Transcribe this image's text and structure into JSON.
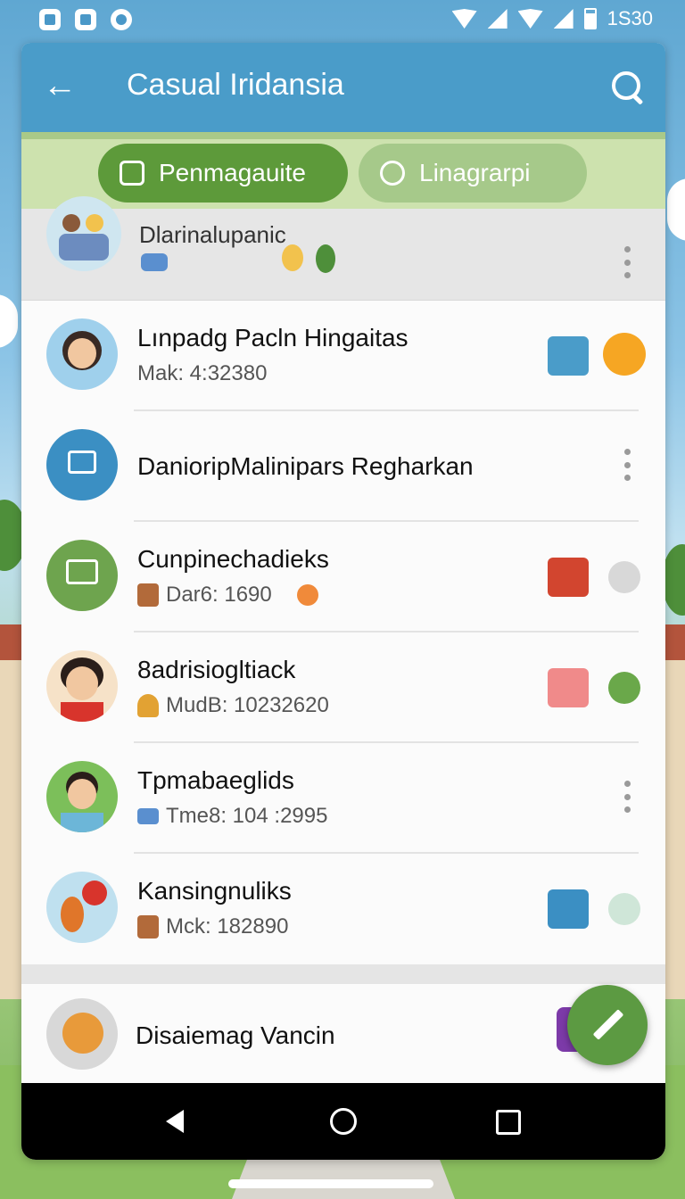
{
  "status_bar": {
    "time": "1S30"
  },
  "app_bar": {
    "title": "Casual Iridansia"
  },
  "tabs": [
    {
      "label": "Penmagauite",
      "active": true
    },
    {
      "label": "Linagrarpi",
      "active": false
    }
  ],
  "header": {
    "label": "Dlarinalupanic"
  },
  "rows": [
    {
      "name": "Lınpadg Pacln Hingaitas",
      "meta": "Mak: 4:32380"
    },
    {
      "name": "DanioripMalinipars Regharkan",
      "meta": ""
    },
    {
      "name": "Cunpinechadieks",
      "meta": "Dar6: 1690"
    },
    {
      "name": "8adrisiogltiack",
      "meta": "MudB: 10232620"
    },
    {
      "name": "Tpmabaeglids",
      "meta": "Tme8: 104 :2995"
    },
    {
      "name": "Kansingnuliks",
      "meta": "Mck: 182890"
    }
  ],
  "last_row": {
    "name": "Disaiemag Vancin"
  },
  "colors": {
    "app_bar": "#4a9cc9",
    "active_tab": "#5d9a3a",
    "fab": "#5c9a42"
  }
}
